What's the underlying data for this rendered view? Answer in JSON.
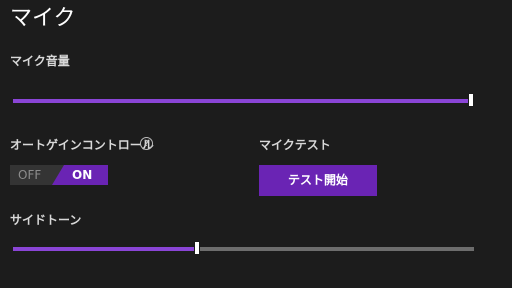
{
  "page": {
    "title": "マイク"
  },
  "mic_volume": {
    "label": "マイク音量",
    "level_percent": 100
  },
  "auto_gain": {
    "label": "オートゲインコントロール",
    "help_symbol": "?",
    "help_icon": "question-circle-icon",
    "toggle": {
      "off_label": "OFF",
      "on_label": "ON",
      "state": "on"
    }
  },
  "mic_test": {
    "label": "マイクテスト",
    "button_label": "テスト開始"
  },
  "sidetone": {
    "label": "サイドトーン",
    "level_percent": 40
  },
  "colors": {
    "background": "#1c1c1c",
    "accent": "#6a24b4",
    "slider_fill": "#8a45d6",
    "slider_track": "#6d6d6d"
  }
}
